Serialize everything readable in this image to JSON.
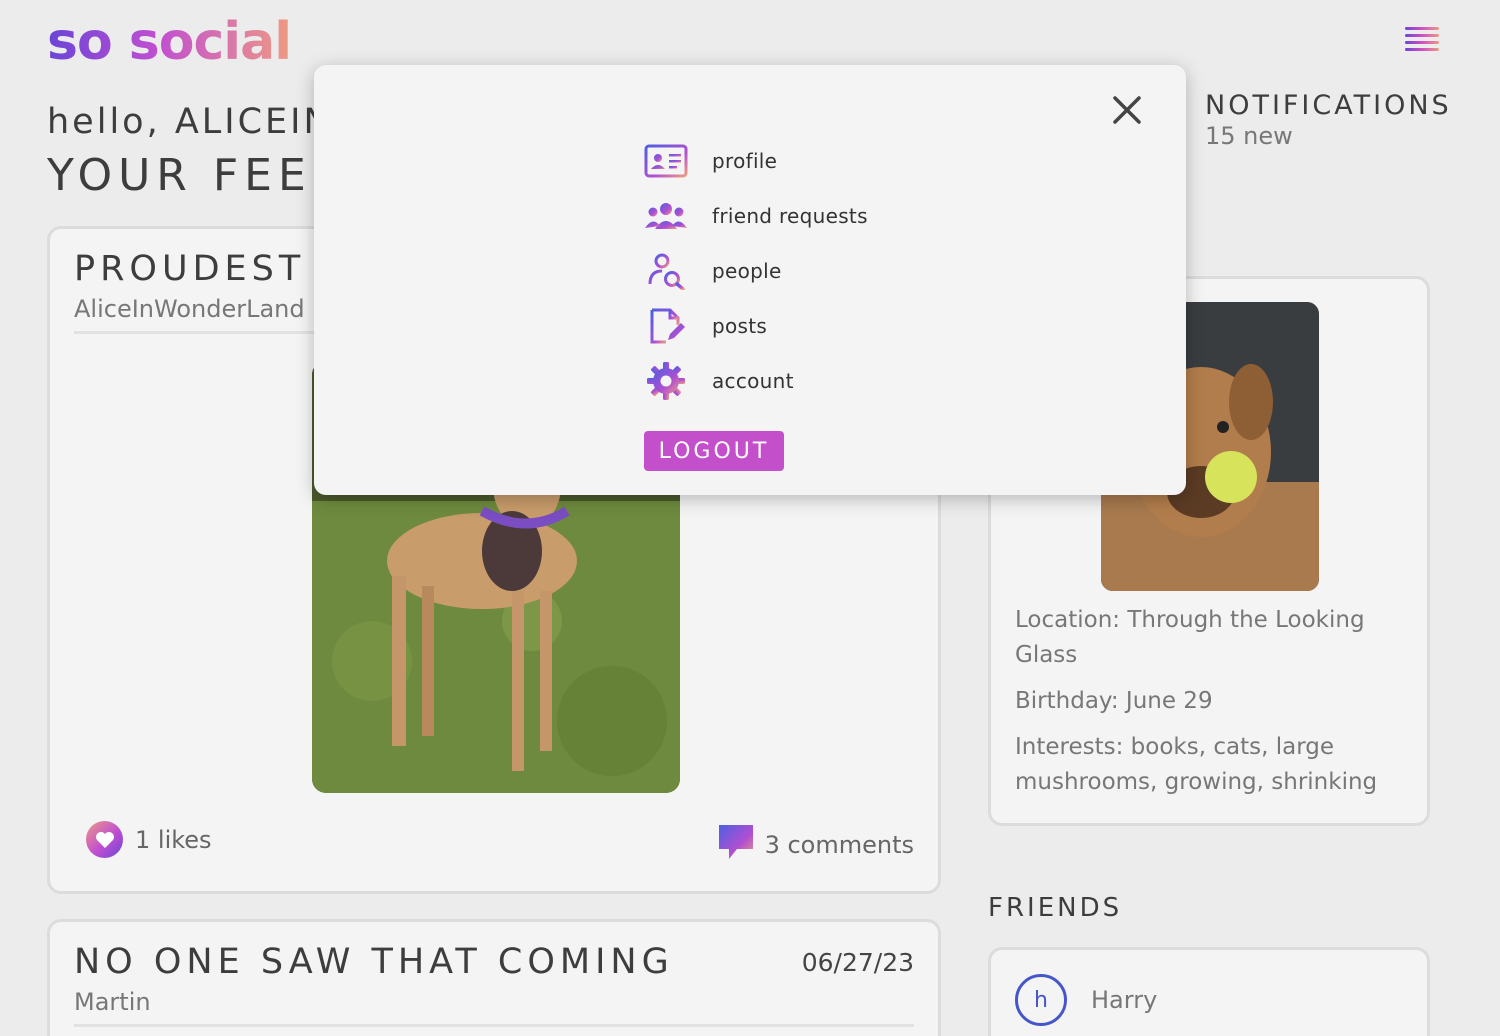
{
  "header": {
    "logo": "so social",
    "menu_icon": "hamburger-menu-icon"
  },
  "greeting": "hello, ALICEIN",
  "feed_title": "YOUR FEED",
  "notifications": {
    "title": "NOTIFICATIONS",
    "count": "15 new"
  },
  "posts": [
    {
      "title": "PROUDEST M",
      "author": "AliceInWonderLand",
      "likes": "1 likes",
      "comments": "3 comments"
    },
    {
      "title": "NO ONE SAW THAT COMING",
      "author": "Martin",
      "date": "06/27/23"
    }
  ],
  "profile": {
    "location": "Location: Through the Looking Glass",
    "birthday": "Birthday: June 29",
    "interests": "Interests: books, cats, large mushrooms, growing, shrinking"
  },
  "friends": {
    "title": "FRIENDS",
    "items": [
      {
        "initial": "h",
        "name": "Harry"
      }
    ]
  },
  "menu": {
    "close_icon": "close-icon",
    "items": [
      {
        "label": "profile",
        "icon": "id-card-icon"
      },
      {
        "label": "friend requests",
        "icon": "group-icon"
      },
      {
        "label": "people",
        "icon": "user-search-icon"
      },
      {
        "label": "posts",
        "icon": "edit-document-icon"
      },
      {
        "label": "account",
        "icon": "gear-icon"
      }
    ],
    "logout_label": "LOGOUT"
  },
  "colors": {
    "gradient_start": "#6a45d6",
    "gradient_mid": "#c04fd1",
    "gradient_end": "#ee9a84",
    "logout_bg": "#c44fcb",
    "avatar_ring": "#4656c9"
  }
}
